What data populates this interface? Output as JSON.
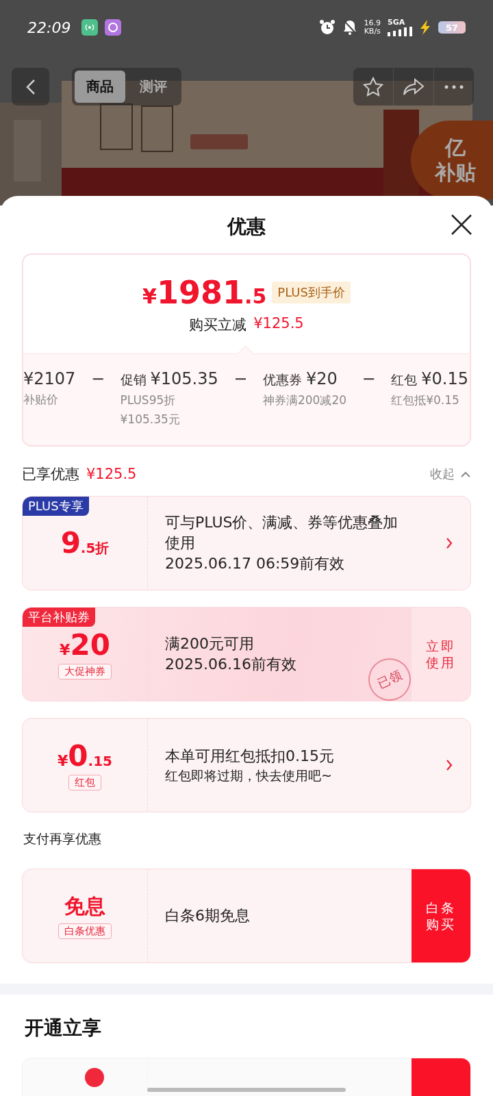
{
  "status_bar": {
    "time": "22:09",
    "net_speed": "16.9",
    "net_speed_unit": "KB/s",
    "network": "5GA",
    "battery": "57"
  },
  "nav": {
    "tabs": [
      {
        "label": "商品",
        "selected": true
      },
      {
        "label": "测评",
        "selected": false
      }
    ]
  },
  "badge": {
    "line_1": "亿",
    "line_2": "补贴"
  },
  "sheet": {
    "title": "优惠",
    "summary": {
      "currency": "¥",
      "price_integer": "1981",
      "price_decimal": ".5",
      "price_tag": "PLUS到手价",
      "reduction_label": "购买立减",
      "reduction_amount": "¥125.5",
      "breakdown": [
        {
          "amount": "¥2107",
          "notes": [
            "补贴价"
          ]
        },
        {
          "operator": "−",
          "label": "促销",
          "amount": "¥105.35",
          "notes": [
            "PLUS95折",
            "¥105.35元"
          ]
        },
        {
          "operator": "−",
          "label": "优惠券",
          "amount": "¥20",
          "notes": [
            "神券满200减20"
          ]
        },
        {
          "operator": "−",
          "label": "红包",
          "amount": "¥0.15",
          "notes": [
            "红包抵¥0.15"
          ]
        }
      ]
    },
    "enjoyed": {
      "label": "已享优惠",
      "amount": "¥125.5",
      "toggle": "收起",
      "expanded": true
    },
    "offers": [
      {
        "kind": "discount",
        "tag": "PLUS专享",
        "color": "#2a3aa6",
        "value": "9",
        "value_decimal": ".5",
        "value_unit": "折",
        "lines": [
          "可与PLUS价、满减、券等优惠叠加使用",
          "2025.06.17 06:59前有效"
        ]
      },
      {
        "kind": "coupon",
        "tag": "平台补贴券",
        "color": "#f0283c",
        "currency": "¥",
        "value": "20",
        "sub_tag": "大促神券",
        "lines": [
          "满200元可用",
          "2025.06.16前有效"
        ],
        "action": "立即使用",
        "stamp": "已领"
      },
      {
        "kind": "red_packet",
        "currency": "¥",
        "value": "0",
        "value_decimal": ".15",
        "sub_tag": "红包",
        "lines": [
          "本单可用红包抵扣0.15元",
          "红包即将过期，快去使用吧~"
        ]
      }
    ],
    "payment_heading": "支付再享优惠",
    "payment_offers": [
      {
        "kind": "interest_free",
        "title": "免息",
        "sub_tag": "白条优惠",
        "lines": [
          "白条6期免息"
        ],
        "action": "白条购买"
      }
    ],
    "membership_heading": "开通立享"
  }
}
